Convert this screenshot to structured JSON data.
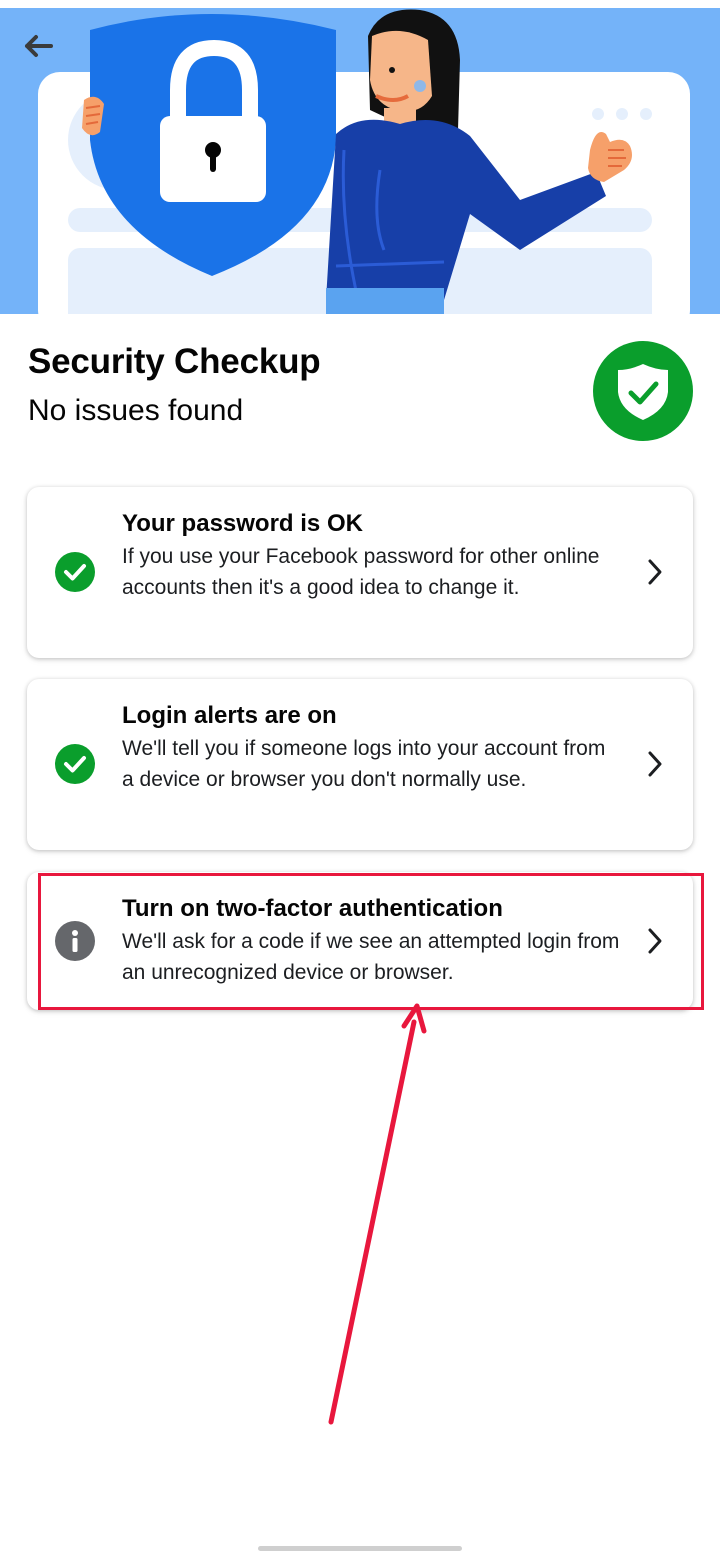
{
  "header": {
    "title": "Security Checkup",
    "subtitle": "No issues found"
  },
  "icons": {
    "back": "arrow-left-icon",
    "status": "shield-check-icon",
    "ok": "check-circle-icon",
    "info": "info-circle-icon",
    "chevron": "chevron-right-icon"
  },
  "items": [
    {
      "title": "Your password is OK",
      "description": "If you use your Facebook password for other online accounts then it's a good idea to change it.",
      "status": "ok"
    },
    {
      "title": "Login alerts are on",
      "description": "We'll tell you if someone logs into your account from a device or browser you don't normally use.",
      "status": "ok"
    },
    {
      "title": "Turn on two-factor authentication",
      "description": "We'll ask for a code if we see an attempted login from an unrecognized device or browser.",
      "status": "info"
    }
  ],
  "colors": {
    "hero_bg": "#6fb1f7",
    "shield_blue": "#1a73e8",
    "success_green": "#0a9e2c",
    "info_gray": "#65676b",
    "annotation_red": "#e8173d"
  }
}
